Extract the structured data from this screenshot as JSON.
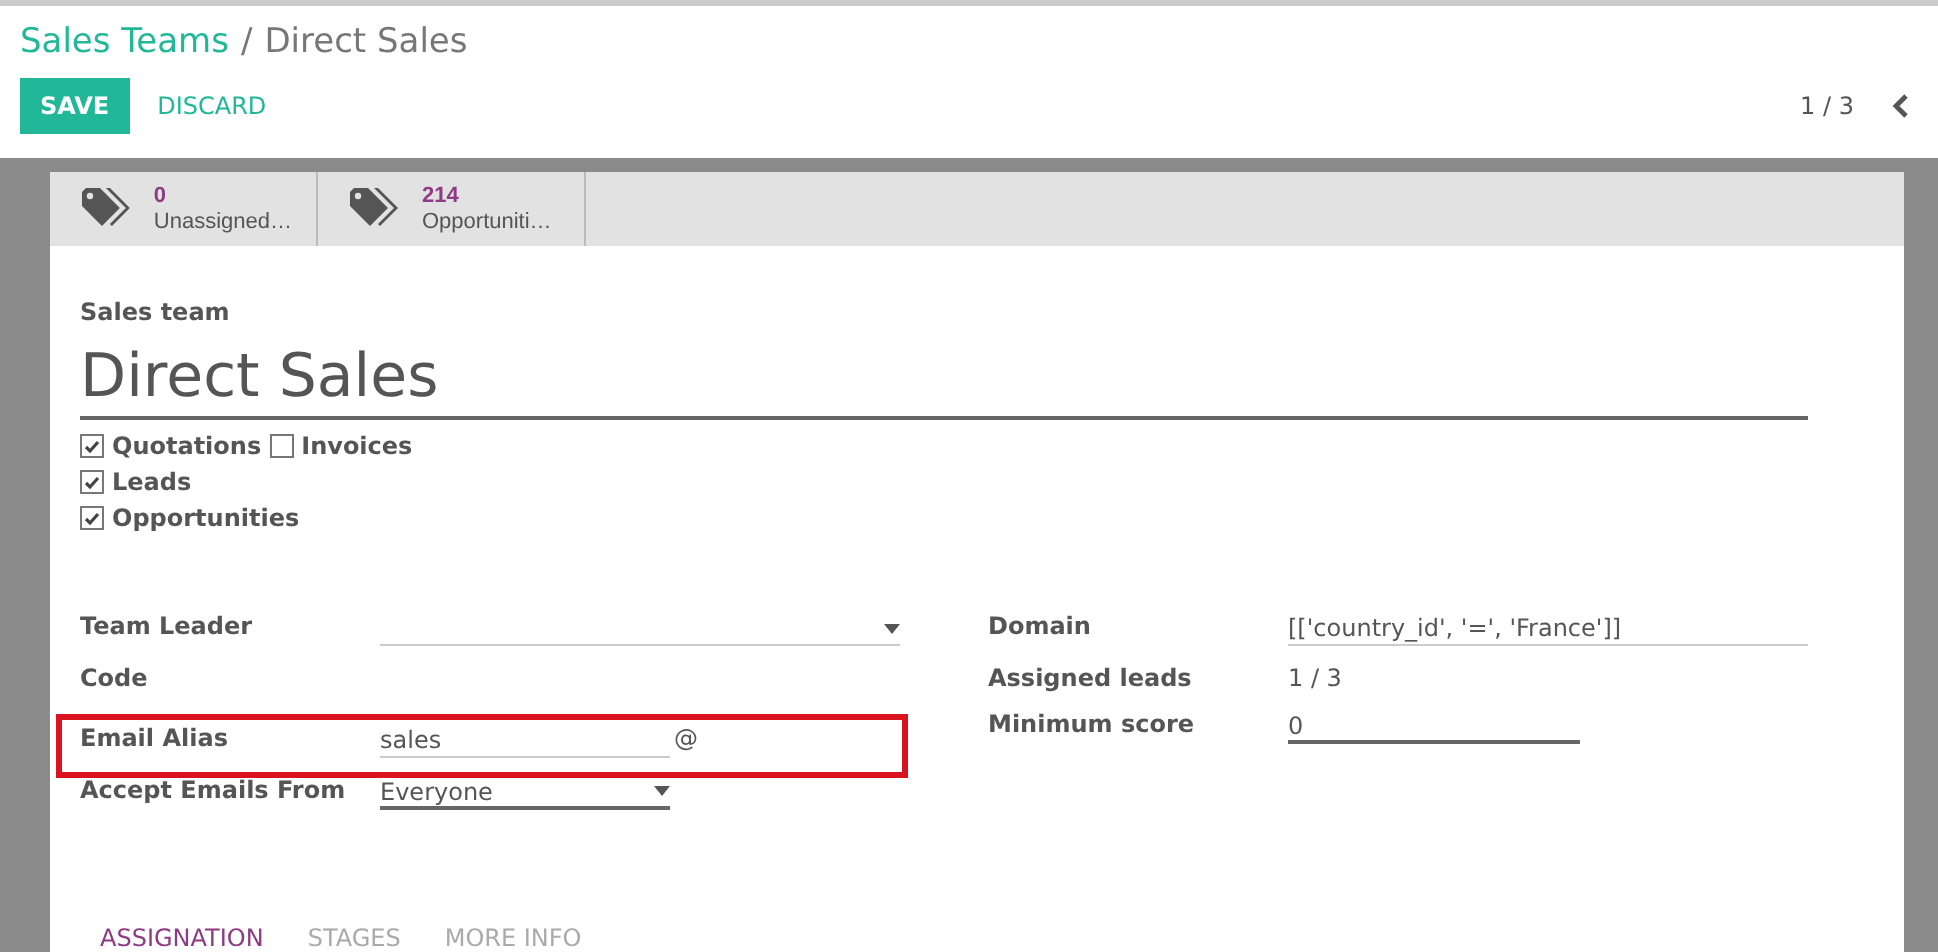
{
  "breadcrumb": {
    "parent": "Sales Teams",
    "separator": "/",
    "current": "Direct Sales"
  },
  "actions": [
    {
      "label": "SAVE",
      "kind": "primary"
    },
    {
      "label": "DISCARD",
      "kind": "link"
    }
  ],
  "pager": {
    "text": "1 / 3"
  },
  "smart_buttons": [
    {
      "count": "0",
      "label": "Unassigned…"
    },
    {
      "count": "214",
      "label": "Opportuniti…"
    }
  ],
  "sheet": {
    "caption": "Sales team",
    "name": "Direct Sales",
    "checkbox_lines": [
      [
        {
          "label": "Quotations",
          "checked": true
        },
        {
          "label": "Invoices",
          "checked": false
        }
      ],
      [
        {
          "label": "Leads",
          "checked": true
        }
      ],
      [
        {
          "label": "Opportunities",
          "checked": true
        }
      ]
    ],
    "left_fields": [
      {
        "label": "Team Leader",
        "kind": "select",
        "highlighted": false
      },
      {
        "label": "Code",
        "kind": "plain",
        "highlighted": false
      },
      {
        "label": "Email Alias",
        "kind": "alias",
        "value": "sales",
        "suffix": "@",
        "highlighted": true
      },
      {
        "label": "Accept Emails From",
        "kind": "short_select",
        "value": "Everyone",
        "highlighted": false
      }
    ],
    "right_fields": [
      {
        "label": "Domain",
        "kind": "input",
        "value": "[['country_id', '=', 'France']]"
      },
      {
        "label": "Assigned leads",
        "kind": "plain",
        "value": "1 / 3"
      },
      {
        "label": "Minimum score",
        "kind": "short_input",
        "value": "0"
      }
    ],
    "tabs": [
      {
        "label": "ASSIGNATION",
        "selected": true
      },
      {
        "label": "STAGES",
        "selected": false
      },
      {
        "label": "MORE INFO",
        "selected": false
      }
    ]
  }
}
